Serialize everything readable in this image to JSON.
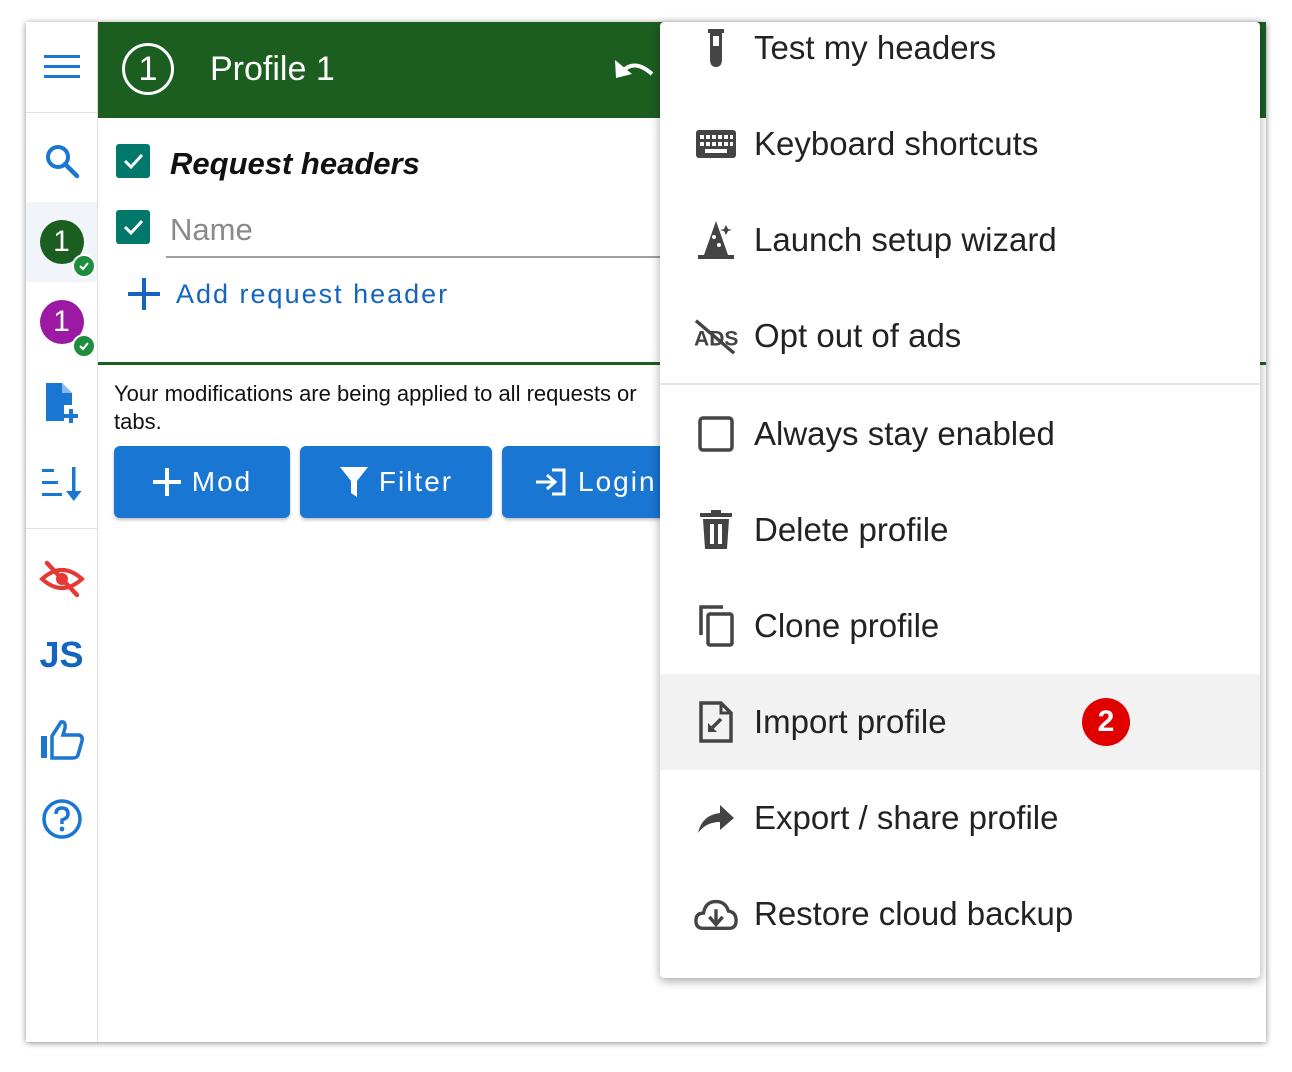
{
  "header": {
    "profile_number": "1",
    "title": "Profile 1"
  },
  "sidebar": {
    "profiles": [
      {
        "number": "1",
        "color": "#1b5e20"
      },
      {
        "number": "1",
        "color": "#9c1aa3"
      }
    ],
    "js_label": "JS"
  },
  "section": {
    "title": "Request headers",
    "name_placeholder": "Name",
    "add_label": "Add request header"
  },
  "info_text": "Your modifications are being applied to all requests or tabs.",
  "actions": {
    "mod": "Mod",
    "filter": "Filter",
    "login": "Login"
  },
  "menu": {
    "items": [
      {
        "icon": "test-tube-icon",
        "label": "Test my headers"
      },
      {
        "icon": "keyboard-icon",
        "label": "Keyboard shortcuts"
      },
      {
        "icon": "wizard-icon",
        "label": "Launch setup wizard"
      },
      {
        "icon": "ads-off-icon",
        "label": "Opt out of ads"
      },
      {
        "icon": "checkbox-icon",
        "label": "Always stay enabled"
      },
      {
        "icon": "trash-icon",
        "label": "Delete profile"
      },
      {
        "icon": "copy-icon",
        "label": "Clone profile"
      },
      {
        "icon": "file-import-icon",
        "label": "Import profile"
      },
      {
        "icon": "share-arrow-icon",
        "label": "Export / share profile"
      },
      {
        "icon": "cloud-download-icon",
        "label": "Restore cloud backup"
      }
    ],
    "step_badge": "2"
  },
  "colors": {
    "header": "#1b5e20",
    "accent": "#1976d2",
    "checkbox": "#00796b",
    "step_badge": "#e00000"
  }
}
